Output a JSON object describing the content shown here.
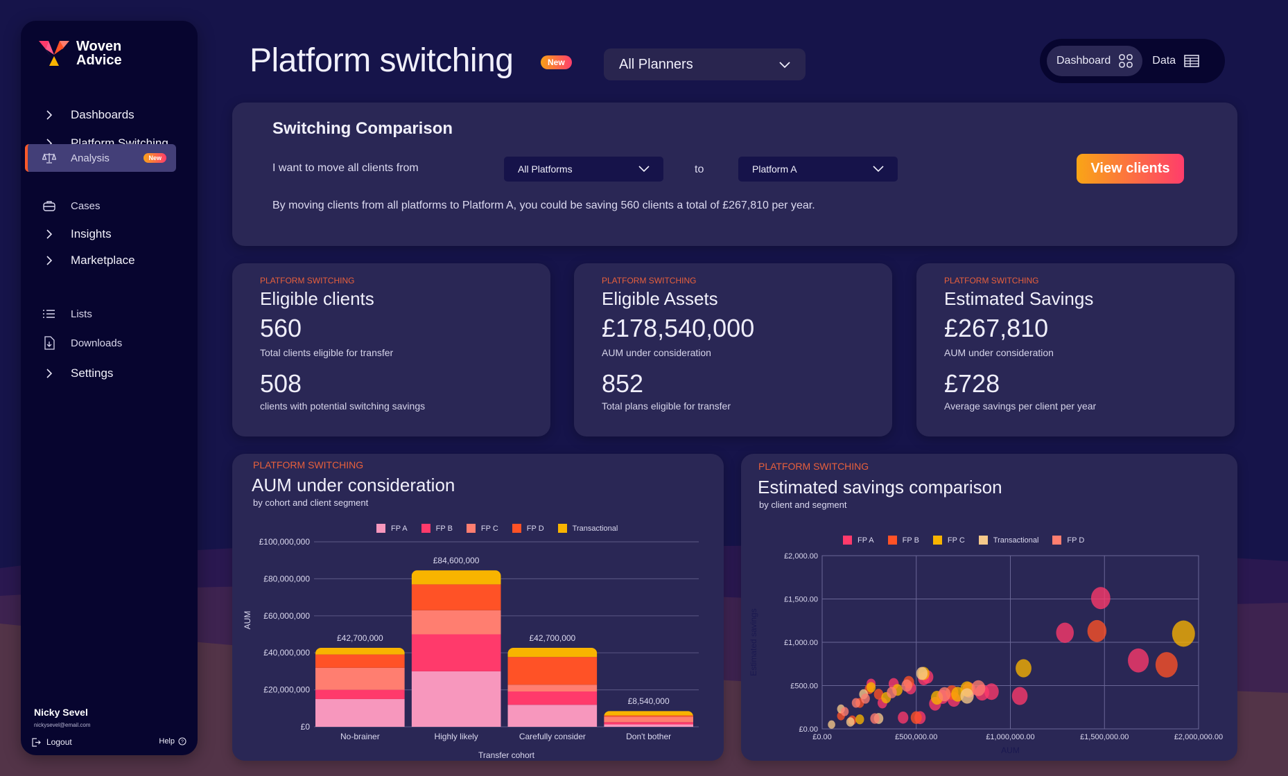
{
  "brand": {
    "name_line1": "Woven",
    "name_line2": "Advice"
  },
  "sidebar": {
    "items": [
      {
        "label": "Dashboards",
        "icon": "chevron-right-icon"
      },
      {
        "label": "Platform Switching",
        "icon": "chevron-right-icon"
      },
      {
        "label": "Analysis",
        "icon": "scales-icon",
        "badge": "New",
        "active": true
      },
      {
        "label": "Cases",
        "icon": "briefcase-icon"
      },
      {
        "label": "Insights",
        "icon": "chevron-right-icon"
      },
      {
        "label": "Marketplace",
        "icon": "chevron-right-icon"
      },
      {
        "label": "Lists",
        "icon": "list-icon"
      },
      {
        "label": "Downloads",
        "icon": "download-file-icon"
      },
      {
        "label": "Settings",
        "icon": "chevron-right-icon"
      }
    ],
    "user": {
      "name": "Nicky Sevel",
      "email": "nickysevel@email.com"
    },
    "logout_label": "Logout",
    "help_label": "Help"
  },
  "header": {
    "title": "Platform switching",
    "badge": "New",
    "planner_select": "All Planners",
    "toggle": {
      "dashboard_label": "Dashboard",
      "data_label": "Data",
      "active": "Dashboard"
    }
  },
  "comparison": {
    "title": "Switching Comparison",
    "lead_text": "I want to move all clients from",
    "from_value": "All Platforms",
    "to_text": "to",
    "to_value": "Platform A",
    "button_label": "View clients",
    "summary": "By moving clients from all platforms to Platform A, you could be saving 560 clients a total of £267,810 per year."
  },
  "kpis": [
    {
      "eyebrow": "PLATFORM SWITCHING",
      "title": "Eligible clients",
      "value": "560",
      "value_label": "Total clients eligible for transfer",
      "value2": "508",
      "value2_label": "clients with potential switching savings"
    },
    {
      "eyebrow": "PLATFORM SWITCHING",
      "title": "Eligible Assets",
      "value": "£178,540,000",
      "value_label": "AUM under consideration",
      "value2": "852",
      "value2_label": "Total plans eligible for transfer"
    },
    {
      "eyebrow": "PLATFORM SWITCHING",
      "title": "Estimated Savings",
      "value": "£267,810",
      "value_label": "AUM under consideration",
      "value2": "£728",
      "value2_label": "Average savings per client per year"
    }
  ],
  "colors": {
    "accent": "#e8603c",
    "fp_a_bar": "#f797bd",
    "fp_b_bar": "#ff3a6b",
    "fp_c_bar": "#ff7e70",
    "fp_d_bar": "#ff5226",
    "transactional_bar": "#f8b400",
    "fp_a_dot": "#ff3a6b",
    "fp_b_dot": "#ff5226",
    "fp_c_dot": "#f8b400",
    "transactional_dot": "#f6c98a",
    "fp_d_dot": "#ff7e70"
  },
  "chart_data": [
    {
      "type": "bar",
      "stacked": true,
      "eyebrow": "PLATFORM SWITCHING",
      "title": "AUM under consideration",
      "subtitle": "by cohort and client segment",
      "xlabel": "Transfer cohort",
      "ylabel": "AUM",
      "ylim": [
        0,
        100000000
      ],
      "yticks": [
        0,
        20000000,
        40000000,
        60000000,
        80000000,
        100000000
      ],
      "ytick_labels": [
        "£0",
        "£20,000,000",
        "£40,000,000",
        "£60,000,000",
        "£80,000,000",
        "£100,000,000"
      ],
      "categories": [
        "No-brainer",
        "Highly likely",
        "Carefully consider",
        "Don't bother"
      ],
      "totals": [
        42700000,
        84600000,
        42700000,
        8540000
      ],
      "total_labels": [
        "£42,700,000",
        "£84,600,000",
        "£42,700,000",
        "£8,540,000"
      ],
      "legend_position": "top",
      "series": [
        {
          "name": "FP A",
          "color": "#f797bd",
          "values": [
            15000000,
            30000000,
            11900000,
            1300000
          ]
        },
        {
          "name": "FP B",
          "color": "#ff3a6b",
          "values": [
            5000000,
            20000000,
            7200000,
            1200000
          ]
        },
        {
          "name": "FP C",
          "color": "#ff7e70",
          "values": [
            11900000,
            13000000,
            3650000,
            3000000
          ]
        },
        {
          "name": "FP D",
          "color": "#ff5226",
          "values": [
            7200000,
            14000000,
            15000000,
            640000
          ]
        },
        {
          "name": "Transactional",
          "color": "#f8b400",
          "values": [
            3600000,
            7600000,
            4950000,
            2400000
          ]
        }
      ]
    },
    {
      "type": "scatter",
      "eyebrow": "PLATFORM SWITCHING",
      "title": "Estimated savings comparison",
      "subtitle": "by client and segment",
      "xlabel": "AUM",
      "ylabel": "Estimated savings",
      "xlim": [
        0,
        2000000
      ],
      "ylim": [
        0,
        2000
      ],
      "xticks": [
        0,
        500000,
        1000000,
        1500000,
        2000000
      ],
      "xtick_labels": [
        "£0.00",
        "£500,000.00",
        "£1,000,000.00",
        "£1,500,000.00",
        "£2,000,000.00"
      ],
      "yticks": [
        0,
        500,
        1000,
        1500,
        2000
      ],
      "ytick_labels": [
        "£0.00",
        "£500.00",
        "£1,000.00",
        "£1,500.00",
        "£2,000.00"
      ],
      "grid": true,
      "legend_position": "top",
      "series": [
        {
          "name": "FP A",
          "color": "#ff3a6b",
          "points": [
            [
              1480000,
              1510.0
            ],
            [
              1290000,
              1110
            ],
            [
              1680000,
              790
            ],
            [
              1050000,
              380
            ],
            [
              430000,
              130
            ],
            [
              520000,
              130
            ],
            [
              320000,
              300
            ],
            [
              560000,
              600
            ],
            [
              600000,
              290
            ],
            [
              700000,
              340
            ],
            [
              850000,
              420
            ],
            [
              900000,
              430
            ],
            [
              380000,
              520
            ],
            [
              470000,
              470
            ],
            [
              260000,
              520
            ],
            [
              540000,
              580
            ],
            [
              780000,
              450
            ],
            [
              640000,
              370
            ]
          ]
        },
        {
          "name": "FP B",
          "color": "#ff5226",
          "points": [
            [
              1460000,
              1130
            ],
            [
              1830000,
              740
            ],
            [
              500000,
              130
            ],
            [
              200000,
              300
            ],
            [
              100000,
              150
            ],
            [
              300000,
              400
            ],
            [
              690000,
              420
            ],
            [
              460000,
              540
            ],
            [
              250000,
              460
            ],
            [
              160000,
              100
            ]
          ]
        },
        {
          "name": "FP C",
          "color": "#f8b400",
          "points": [
            [
              1070000,
              700
            ],
            [
              1920000,
              1100
            ],
            [
              610000,
              360
            ],
            [
              720000,
              400
            ],
            [
              770000,
              460
            ],
            [
              200000,
              110
            ],
            [
              340000,
              360
            ],
            [
              400000,
              450
            ],
            [
              260000,
              480
            ],
            [
              540000,
              640
            ]
          ]
        },
        {
          "name": "Transactional",
          "color": "#f6c98a",
          "points": [
            [
              770000,
              380
            ],
            [
              530000,
              640
            ],
            [
              100000,
              230
            ],
            [
              50000,
              50
            ],
            [
              150000,
              80
            ],
            [
              300000,
              120
            ],
            [
              220000,
              400
            ]
          ]
        },
        {
          "name": "FP D",
          "color": "#ff7e70",
          "points": [
            [
              830000,
              470
            ],
            [
              450000,
              500
            ],
            [
              180000,
              300
            ],
            [
              280000,
              120
            ],
            [
              120000,
              200
            ],
            [
              370000,
              420
            ],
            [
              650000,
              400
            ],
            [
              230000,
              350
            ]
          ]
        }
      ]
    }
  ]
}
